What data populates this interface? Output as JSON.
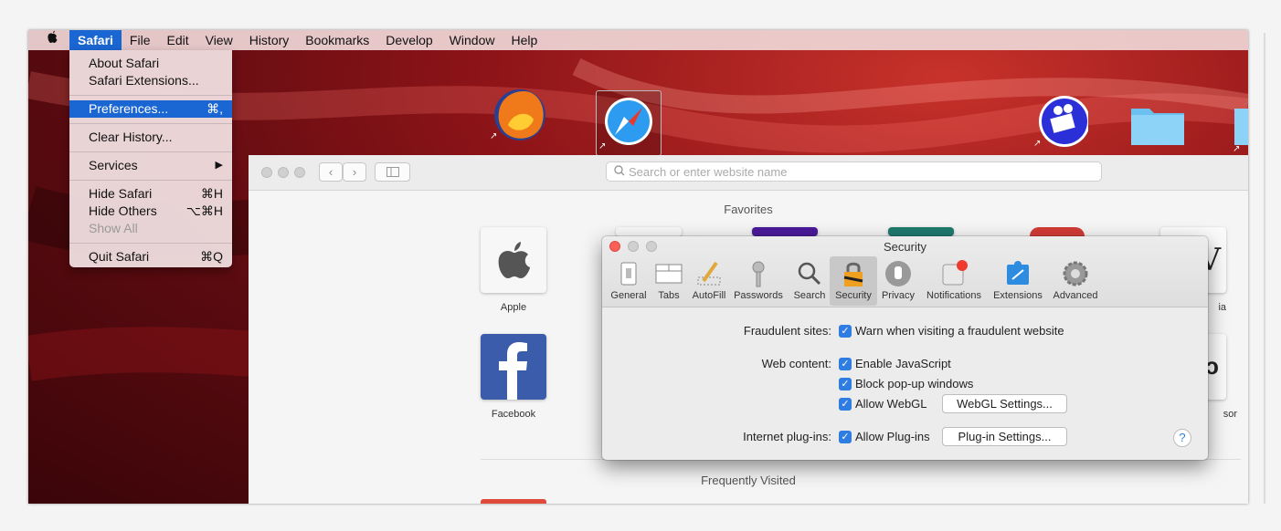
{
  "menubar": {
    "app": "Safari",
    "items": [
      "File",
      "Edit",
      "View",
      "History",
      "Bookmarks",
      "Develop",
      "Window",
      "Help"
    ]
  },
  "safari_menu": {
    "about": "About Safari",
    "extensions": "Safari Extensions...",
    "preferences": "Preferences...",
    "preferences_shortcut": "⌘,",
    "clear_history": "Clear History...",
    "services": "Services",
    "services_arrow": "▶",
    "hide_safari": "Hide Safari",
    "hide_safari_shortcut": "⌘H",
    "hide_others": "Hide Others",
    "hide_others_shortcut": "⌥⌘H",
    "show_all": "Show All",
    "quit": "Quit Safari",
    "quit_shortcut": "⌘Q"
  },
  "safari_window": {
    "search_placeholder": "Search or enter website name",
    "favorites_title": "Favorites",
    "frequently_visited_title": "Frequently Visited",
    "favorites": [
      {
        "label": "Apple"
      },
      {
        "label": "Facebook"
      }
    ],
    "partial_labels": [
      "ia",
      "sor"
    ]
  },
  "prefs": {
    "title": "Security",
    "tabs": [
      {
        "label": "General",
        "icon": "general-icon"
      },
      {
        "label": "Tabs",
        "icon": "tabs-icon"
      },
      {
        "label": "AutoFill",
        "icon": "autofill-icon"
      },
      {
        "label": "Passwords",
        "icon": "key-icon"
      },
      {
        "label": "Search",
        "icon": "search-icon"
      },
      {
        "label": "Security",
        "icon": "lock-icon"
      },
      {
        "label": "Privacy",
        "icon": "hand-icon"
      },
      {
        "label": "Notifications",
        "icon": "notifications-icon"
      },
      {
        "label": "Extensions",
        "icon": "extensions-icon"
      },
      {
        "label": "Advanced",
        "icon": "gear-icon"
      }
    ],
    "fraudulent_label": "Fraudulent sites:",
    "fraudulent_option": "Warn when visiting a fraudulent website",
    "web_content_label": "Web content:",
    "enable_js": "Enable JavaScript",
    "block_popups": "Block pop-up windows",
    "allow_webgl": "Allow WebGL",
    "webgl_settings": "WebGL Settings...",
    "plugins_label": "Internet plug-ins:",
    "allow_plugins": "Allow Plug-ins",
    "plugin_settings": "Plug-in Settings...",
    "help": "?",
    "check": "✓"
  },
  "colors": {
    "selection_blue": "#1a66d2",
    "checkbox_blue": "#2f7de1"
  }
}
